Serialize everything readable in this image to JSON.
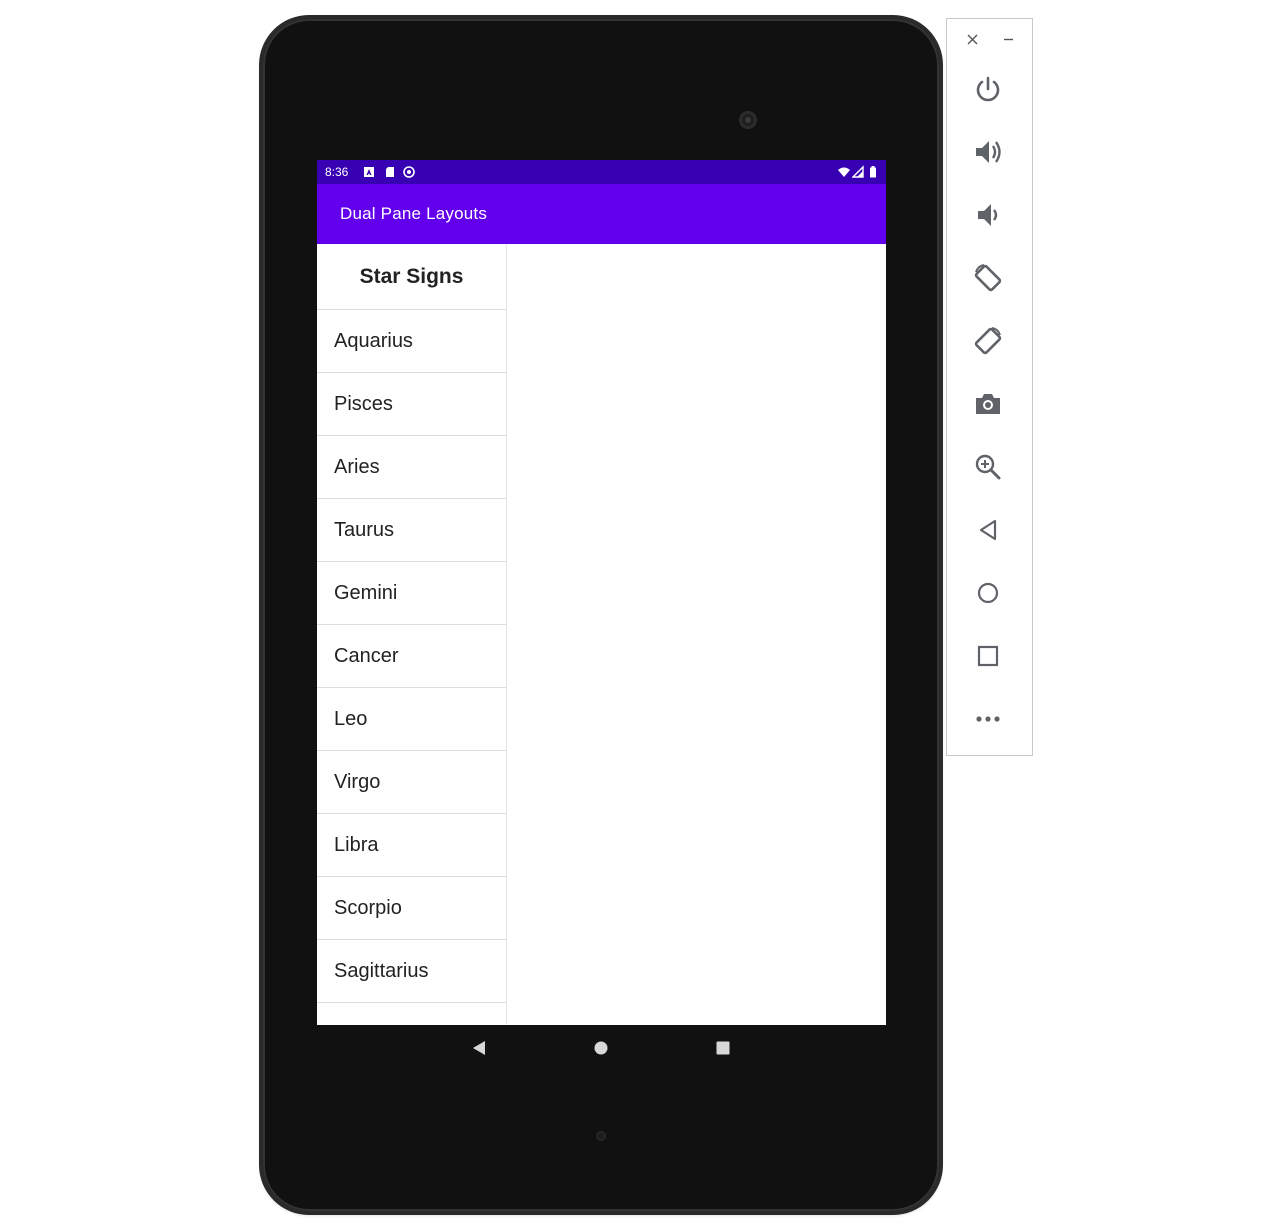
{
  "status_bar": {
    "time": "8:36"
  },
  "toolbar": {
    "title": "Dual Pane Layouts"
  },
  "list": {
    "header": "Star Signs",
    "items": [
      {
        "label": "Aquarius"
      },
      {
        "label": "Pisces"
      },
      {
        "label": "Aries"
      },
      {
        "label": "Taurus"
      },
      {
        "label": "Gemini"
      },
      {
        "label": "Cancer"
      },
      {
        "label": "Leo"
      },
      {
        "label": "Virgo"
      },
      {
        "label": "Libra"
      },
      {
        "label": "Scorpio"
      },
      {
        "label": "Sagittarius"
      }
    ]
  },
  "colors": {
    "status_bar": "#3700b3",
    "toolbar": "#6200ee",
    "device": "#111111"
  },
  "emulator_panel": {
    "buttons": [
      "power-icon",
      "volume-up-icon",
      "volume-down-icon",
      "rotate-left-icon",
      "rotate-right-icon",
      "camera-icon",
      "zoom-icon",
      "back-icon",
      "home-icon",
      "overview-icon",
      "more-icon"
    ]
  }
}
